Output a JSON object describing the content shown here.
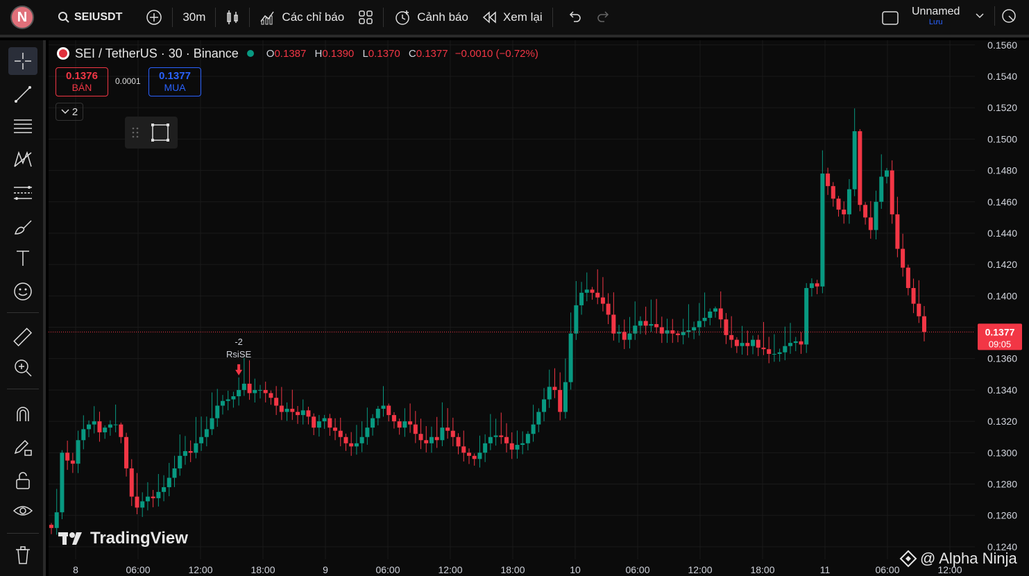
{
  "toolbar": {
    "avatar_letter": "N",
    "symbol": "SEIUSDT",
    "interval": "30m",
    "indicators_label": "Các chỉ báo",
    "alert_label": "Cảnh báo",
    "replay_label": "Xem lại",
    "layout_name": "Unnamed",
    "save_label": "Lưu"
  },
  "legend": {
    "title": "SEI / TetherUS · 30 · Binance",
    "o_label": "O",
    "o_value": "0.1387",
    "h_label": "H",
    "h_value": "0.1390",
    "l_label": "L",
    "l_value": "0.1370",
    "c_label": "C",
    "c_value": "0.1377",
    "change": "−0.0010 (−0.72%)"
  },
  "trade": {
    "sell_price": "0.1376",
    "sell_label": "BÁN",
    "spread": "0.0001",
    "buy_price": "0.1377",
    "buy_label": "MUA",
    "collapsed_count": "2"
  },
  "annotation": {
    "value": "-2",
    "label": "RsiSE"
  },
  "branding": {
    "logo": "TradingView",
    "watermark": "@ Alpha Ninja"
  },
  "colors": {
    "up": "#089981",
    "down": "#f23645",
    "background": "#0b0b0b"
  },
  "chart_data": {
    "type": "candlestick",
    "y_ticks": [
      "0.1560",
      "0.1540",
      "0.1520",
      "0.1500",
      "0.1480",
      "0.1460",
      "0.1440",
      "0.1420",
      "0.1400",
      "0.1380",
      "0.1360",
      "0.1340",
      "0.1320",
      "0.1300",
      "0.1280",
      "0.1260",
      "0.1240"
    ],
    "x_ticks": [
      "8",
      "06:00",
      "12:00",
      "18:00",
      "9",
      "06:00",
      "12:00",
      "18:00",
      "10",
      "06:00",
      "12:00",
      "18:00",
      "11",
      "06:00",
      "12:00"
    ],
    "ylim": [
      0.1232,
      0.1563
    ],
    "last_price": "0.1377",
    "countdown": "09:05",
    "close_series": [
      0.1252,
      0.1262,
      0.13,
      0.1295,
      0.1293,
      0.1308,
      0.1315,
      0.1318,
      0.132,
      0.1313,
      0.1316,
      0.1318,
      0.1318,
      0.131,
      0.129,
      0.1272,
      0.1265,
      0.1269,
      0.1272,
      0.1271,
      0.1275,
      0.1278,
      0.1284,
      0.129,
      0.1298,
      0.1301,
      0.13,
      0.1306,
      0.131,
      0.1315,
      0.1322,
      0.133,
      0.1333,
      0.1334,
      0.1336,
      0.134,
      0.1344,
      0.1338,
      0.134,
      0.134,
      0.1338,
      0.1335,
      0.133,
      0.1326,
      0.1328,
      0.1326,
      0.1324,
      0.1327,
      0.1323,
      0.1316,
      0.132,
      0.1322,
      0.1316,
      0.1314,
      0.131,
      0.1306,
      0.1304,
      0.1306,
      0.131,
      0.1316,
      0.1322,
      0.1328,
      0.133,
      0.1324,
      0.132,
      0.1316,
      0.132,
      0.1318,
      0.1312,
      0.1308,
      0.1306,
      0.131,
      0.1308,
      0.1316,
      0.1314,
      0.131,
      0.1304,
      0.13,
      0.1298,
      0.1296,
      0.13,
      0.1306,
      0.131,
      0.1311,
      0.131,
      0.1306,
      0.1302,
      0.1305,
      0.1306,
      0.1312,
      0.1318,
      0.1326,
      0.1334,
      0.1342,
      0.134,
      0.1326,
      0.1345,
      0.1376,
      0.1394,
      0.1402,
      0.1404,
      0.1402,
      0.1399,
      0.1395,
      0.1388,
      0.1376,
      0.1377,
      0.1372,
      0.1376,
      0.1381,
      0.1384,
      0.1381,
      0.1382,
      0.138,
      0.1376,
      0.1378,
      0.1376,
      0.1375,
      0.1377,
      0.1378,
      0.138,
      0.1384,
      0.1386,
      0.139,
      0.1392,
      0.1385,
      0.1375,
      0.1372,
      0.1368,
      0.137,
      0.1368,
      0.1372,
      0.1367,
      0.1366,
      0.1363,
      0.1363,
      0.1364,
      0.1368,
      0.137,
      0.1371,
      0.1369,
      0.1405,
      0.1408,
      0.1406,
      0.1478,
      0.147,
      0.1462,
      0.1455,
      0.1452,
      0.1468,
      0.1505,
      0.1458,
      0.145,
      0.1442,
      0.146,
      0.1476,
      0.148,
      0.1452,
      0.143,
      0.1418,
      0.1405,
      0.1395,
      0.1387,
      0.1377
    ]
  }
}
